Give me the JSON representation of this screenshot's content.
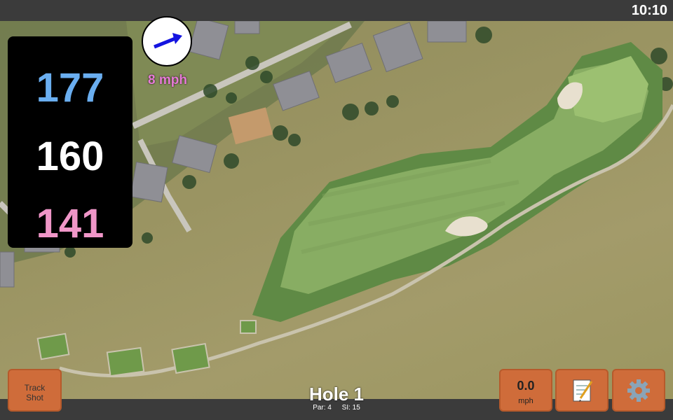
{
  "status": {
    "time": "10:10"
  },
  "yardages": {
    "back": "177",
    "middle": "160",
    "front": "141"
  },
  "wind": {
    "speed_label": "8 mph",
    "direction_icon": "wind-arrow-icon"
  },
  "hole": {
    "title": "Hole 1",
    "par_label": "Par: 4",
    "si_label": "SI: 15"
  },
  "buttons": {
    "track_shot": {
      "line1": "Track",
      "line2": "Shot"
    },
    "speed": {
      "value": "0.0",
      "unit": "mph"
    },
    "notes_icon": "notepad-icon",
    "settings_icon": "gear-icon"
  },
  "colors": {
    "back_yardage": "#6aaef0",
    "middle_yardage": "#ffffff",
    "front_yardage": "#f096c8",
    "button_accent": "#cf6c3a",
    "wind_label": "#e67bd6"
  }
}
